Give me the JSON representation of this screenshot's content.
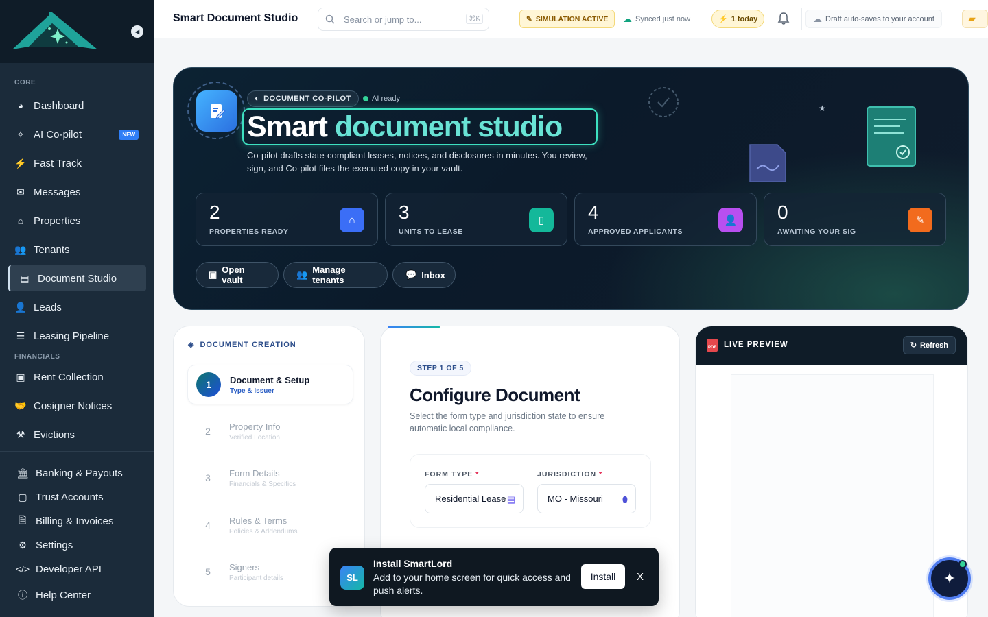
{
  "sidebar": {
    "sections": {
      "core": "CORE",
      "financials": "FINANCIALS"
    },
    "items": [
      {
        "label": "Dashboard",
        "icon": "dashboard-icon"
      },
      {
        "label": "AI Co-pilot",
        "icon": "magic-wand-icon",
        "badge": "NEW"
      },
      {
        "label": "Fast Track",
        "icon": "bolt-icon"
      },
      {
        "label": "Messages",
        "icon": "envelope-icon"
      },
      {
        "label": "Properties",
        "icon": "home-icon"
      },
      {
        "label": "Tenants",
        "icon": "users-icon"
      },
      {
        "label": "Document Studio",
        "icon": "document-icon",
        "active": true
      },
      {
        "label": "Leads",
        "icon": "user-plus-icon"
      },
      {
        "label": "Leasing Pipeline",
        "icon": "list-icon"
      },
      {
        "label": "Rent Collection",
        "icon": "money-icon"
      },
      {
        "label": "Cosigner Notices",
        "icon": "handshake-icon"
      },
      {
        "label": "Evictions",
        "icon": "gavel-icon"
      },
      {
        "label": "Banking & Payouts",
        "icon": "bank-icon"
      },
      {
        "label": "Trust Accounts",
        "icon": "vault-icon"
      },
      {
        "label": "Billing & Invoices",
        "icon": "invoice-icon"
      },
      {
        "label": "Settings",
        "icon": "gear-icon"
      },
      {
        "label": "Developer API",
        "icon": "code-icon"
      },
      {
        "label": "Help Center",
        "icon": "help-icon"
      }
    ]
  },
  "topbar": {
    "title": "Smart Document Studio",
    "search_placeholder": "Search or jump to...",
    "search_shortcut": "⌘K",
    "simulation": "SIMULATION ACTIVE",
    "synced": "Synced just now",
    "today": "1 today",
    "draft": "Draft auto-saves to your account"
  },
  "hero": {
    "tag": "DOCUMENT CO-PILOT",
    "ai_status": "AI ready",
    "title_a": "Smart ",
    "title_b": "document studio",
    "subtitle": "Co-pilot drafts state-compliant leases, notices, and disclosures in minutes. You review, sign, and Co-pilot files the executed copy in your vault.",
    "stats": [
      {
        "value": "2",
        "label": "PROPERTIES READY",
        "color": "#3b6ef6"
      },
      {
        "value": "3",
        "label": "UNITS TO LEASE",
        "color": "#14b89a"
      },
      {
        "value": "4",
        "label": "APPROVED APPLICANTS",
        "color": "#b84ff0"
      },
      {
        "value": "0",
        "label": "AWAITING YOUR SIG",
        "color": "#f26b1d"
      }
    ],
    "buttons": {
      "vault": "Open vault",
      "tenants": "Manage tenants",
      "inbox": "Inbox"
    }
  },
  "creation": {
    "heading": "DOCUMENT CREATION",
    "steps": [
      {
        "num": "1",
        "title": "Document & Setup",
        "sub": "Type & Issuer"
      },
      {
        "num": "2",
        "title": "Property Info",
        "sub": "Verified Location"
      },
      {
        "num": "3",
        "title": "Form Details",
        "sub": "Financials & Specifics"
      },
      {
        "num": "4",
        "title": "Rules & Terms",
        "sub": "Policies & Addendums"
      },
      {
        "num": "5",
        "title": "Signers",
        "sub": "Participant details"
      }
    ]
  },
  "configure": {
    "step": "STEP 1 OF 5",
    "title": "Configure Document",
    "subtitle": "Select the form type and jurisdiction state to ensure automatic local compliance.",
    "form_type_label": "FORM TYPE",
    "form_type_value": "Residential Lease",
    "jurisdiction_label": "JURISDICTION",
    "jurisdiction_value": "MO - Missouri",
    "required_mark": "*"
  },
  "preview": {
    "title": "LIVE PREVIEW",
    "refresh": "Refresh",
    "pdf_badge": "PDF"
  },
  "toast": {
    "avatar": "SL",
    "title": "Install SmartLord",
    "message": "Add to your home screen for quick access and push alerts.",
    "install": "Install",
    "close": "X"
  }
}
